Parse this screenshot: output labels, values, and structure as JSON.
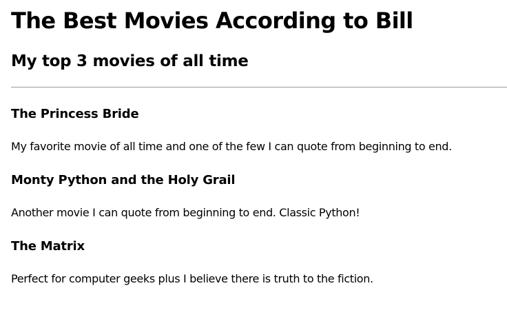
{
  "page": {
    "title": "The Best Movies According to Bill",
    "subtitle": "My top 3 movies of all time"
  },
  "movies": [
    {
      "title": "The Princess Bride",
      "description": "My favorite movie of all time and one of the few I can quote from beginning to end."
    },
    {
      "title": "Monty Python and the Holy Grail",
      "description": "Another movie I can quote from beginning to end. Classic Python!"
    },
    {
      "title": "The Matrix",
      "description": "Perfect for computer geeks plus I believe there is truth to the fiction."
    }
  ]
}
